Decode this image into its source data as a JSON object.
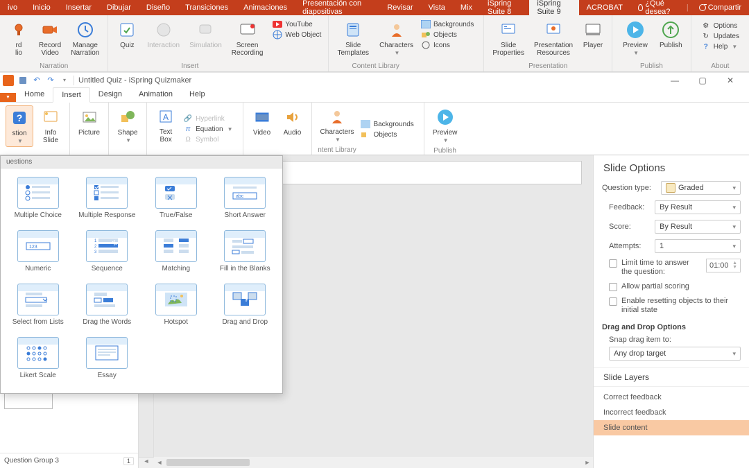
{
  "ppt_tabs": [
    "ivo",
    "Inicio",
    "Insertar",
    "Dibujar",
    "Diseño",
    "Transiciones",
    "Animaciones",
    "Presentación con diapositivas",
    "Revisar",
    "Vista",
    "Mix",
    "iSpring Suite 8",
    "iSpring Suite 9",
    "ACROBAT"
  ],
  "ppt_active_tab": "iSpring Suite 9",
  "ppt_tell_me": "¿Qué desea?",
  "ppt_share": "Compartir",
  "ppt_ribbon": {
    "narr": {
      "rec_audio": "rd\nlio",
      "rec_video": "Record\nVideo",
      "manage": "Manage\nNarration",
      "label": "Narration"
    },
    "insert": {
      "quiz": "Quiz",
      "inter": "Interaction",
      "sim": "Simulation",
      "scr": "Screen\nRecording",
      "yt": "YouTube",
      "web": "Web Object",
      "label": "Insert"
    },
    "cl": {
      "st": "Slide\nTemplates",
      "ch": "Characters",
      "bg": "Backgrounds",
      "obj": "Objects",
      "ico": "Icons",
      "label": "Content Library"
    },
    "pres": {
      "sp": "Slide\nProperties",
      "pr": "Presentation\nResources",
      "pl": "Player",
      "label": "Presentation"
    },
    "pub": {
      "prev": "Preview",
      "pub": "Publish",
      "label": "Publish"
    },
    "about": {
      "opt": "Options",
      "upd": "Updates",
      "hlp": "Help",
      "label": "About"
    }
  },
  "qm": {
    "title": "Untitled Quiz - iSpring Quizmaker",
    "tabs": [
      "Home",
      "Insert",
      "Design",
      "Animation",
      "Help"
    ],
    "active_tab": "Insert",
    "ribbon": {
      "question": "stion",
      "info": "Info\nSlide",
      "pic": "Picture",
      "shape": "Shape",
      "tb": "Text\nBox",
      "hyper": "Hyperlink",
      "eq": "Equation",
      "sym": "Symbol",
      "video": "Video",
      "audio": "Audio",
      "chars": "Characters",
      "bg": "Backgrounds",
      "obj": "Objects",
      "cl_label": "ntent Library",
      "prev": "Preview",
      "publish": "Publish"
    },
    "gallery_hdr": "uestions",
    "questions": [
      "Multiple Choice",
      "Multiple Response",
      "True/False",
      "Short Answer",
      "Numeric",
      "Sequence",
      "Matching",
      "Fill in the Blanks",
      "Select from Lists",
      "Drag the Words",
      "Hotspot",
      "Drag and Drop",
      "Likert Scale",
      "Essay"
    ],
    "footer_group": "Question Group 3",
    "footer_num": "1"
  },
  "side": {
    "title": "Slide Options",
    "qt_lbl": "Question type:",
    "qt_val": "Graded",
    "fb_lbl": "Feedback:",
    "fb_val": "By Result",
    "sc_lbl": "Score:",
    "sc_val": "By Result",
    "at_lbl": "Attempts:",
    "at_val": "1",
    "lim": "Limit time to answer the question:",
    "lim_time": "01:00",
    "partial": "Allow partial scoring",
    "reset": "Enable resetting objects to their initial state",
    "dnd_hdr": "Drag and Drop Options",
    "snap_lbl": "Snap drag item to:",
    "snap_val": "Any drop target",
    "layers_hdr": "Slide Layers",
    "layers": [
      "Correct feedback",
      "Incorrect feedback",
      "Slide content"
    ],
    "layer_sel": "Slide content"
  }
}
